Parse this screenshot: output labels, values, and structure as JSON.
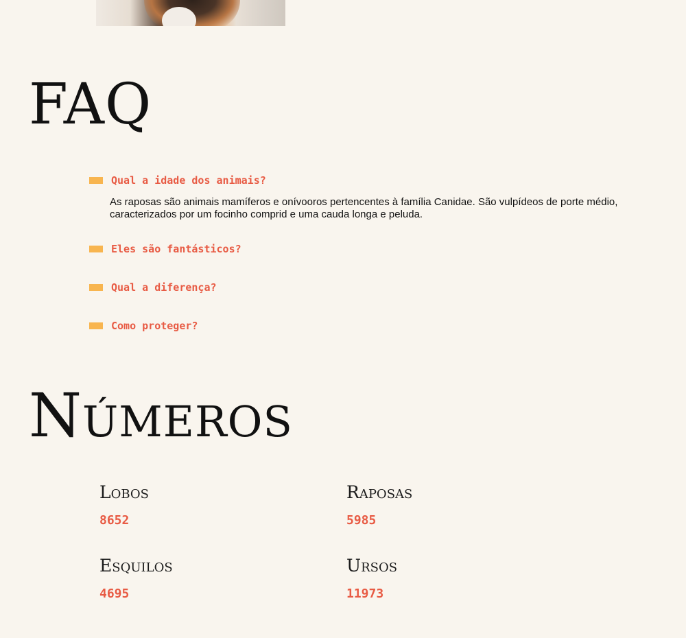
{
  "faq": {
    "title": "FAQ",
    "items": [
      {
        "question": "Qual a idade dos animais?",
        "answer": "As raposas são animais mamíferos e onívooros pertencentes à família Canidae. São vulpídeos de porte médio, caracterizados por um focinho comprid e uma cauda longa e peluda."
      },
      {
        "question": "Eles são fantásticos?"
      },
      {
        "question": "Qual a diferença?"
      },
      {
        "question": "Como proteger?"
      }
    ]
  },
  "numbers": {
    "title": "Números",
    "stats": [
      {
        "label": "Lobos",
        "value": "8652"
      },
      {
        "label": "Raposas",
        "value": "5985"
      },
      {
        "label": "Esquilos",
        "value": "4695"
      },
      {
        "label": "Ursos",
        "value": "11973"
      }
    ]
  },
  "colors": {
    "background": "#f9f5ee",
    "accent": "#e85b44",
    "bullet": "#f8b54f"
  }
}
